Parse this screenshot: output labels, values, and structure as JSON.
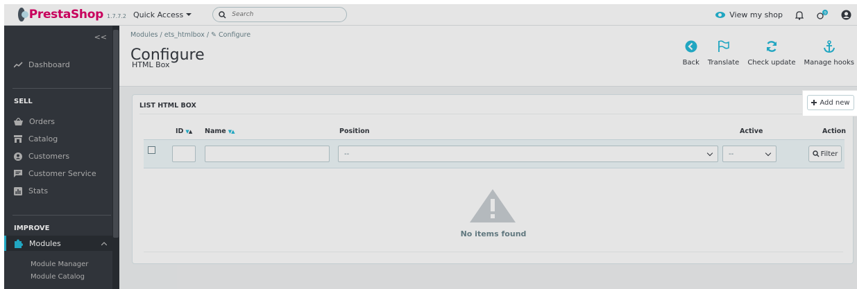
{
  "brand": {
    "name": "PrestaShop",
    "version": "1.7.7.2"
  },
  "topbar": {
    "quick_access": "Quick Access",
    "search_placeholder": "Search",
    "view_shop": "View my shop"
  },
  "sidebar": {
    "collapse": "<<",
    "dashboard": "Dashboard",
    "sell_title": "SELL",
    "sell_items": [
      "Orders",
      "Catalog",
      "Customers",
      "Customer Service",
      "Stats"
    ],
    "improve_title": "IMPROVE",
    "modules": "Modules",
    "module_sub": [
      "Module Manager",
      "Module Catalog"
    ]
  },
  "header": {
    "breadcrumb": "Modules  /  ets_htmlbox  /  ✎ Configure",
    "title": "Configure",
    "subtitle": "HTML Box",
    "toolbar": [
      "Back",
      "Translate",
      "Check update",
      "Manage hooks"
    ]
  },
  "panel": {
    "heading": "LIST HTML BOX",
    "add_new": "Add new",
    "columns": {
      "id": "ID",
      "name": "Name",
      "position": "Position",
      "active": "Active",
      "action": "Action"
    },
    "position_value": "--",
    "active_value": "--",
    "filter_label": "Filter",
    "empty_text": "No items found"
  },
  "colors": {
    "accent": "#25b9d7",
    "brand": "#df0067",
    "sidebar": "#363a41"
  }
}
